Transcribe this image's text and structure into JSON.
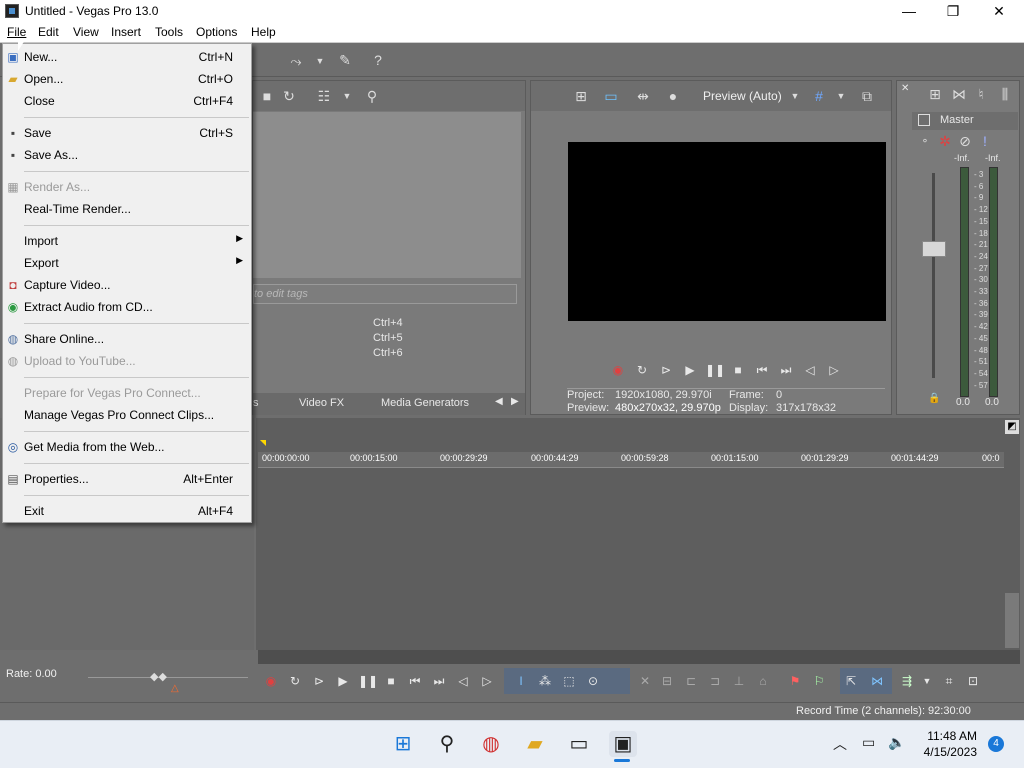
{
  "window": {
    "title": "Untitled - Vegas Pro 13.0",
    "minimize": "—",
    "maximize": "❐",
    "close": "✕"
  },
  "menubar": [
    "File",
    "Edit",
    "View",
    "Insert",
    "Tools",
    "Options",
    "Help"
  ],
  "file_menu": {
    "new": {
      "label": "New...",
      "shortcut": "Ctrl+N"
    },
    "open": {
      "label": "Open...",
      "shortcut": "Ctrl+O"
    },
    "close": {
      "label": "Close",
      "shortcut": "Ctrl+F4"
    },
    "save": {
      "label": "Save",
      "shortcut": "Ctrl+S"
    },
    "save_as": {
      "label": "Save As..."
    },
    "render_as": {
      "label": "Render As..."
    },
    "realtime": {
      "label": "Real-Time Render..."
    },
    "import": {
      "label": "Import"
    },
    "export": {
      "label": "Export"
    },
    "capture": {
      "label": "Capture Video..."
    },
    "extract": {
      "label": "Extract Audio from CD..."
    },
    "share": {
      "label": "Share Online..."
    },
    "upload": {
      "label": "Upload to YouTube..."
    },
    "prepare": {
      "label": "Prepare for Vegas Pro Connect..."
    },
    "manage": {
      "label": "Manage Vegas Pro Connect Clips..."
    },
    "getmedia": {
      "label": "Get Media from the Web..."
    },
    "properties": {
      "label": "Properties...",
      "shortcut": "Alt+Enter"
    },
    "exit": {
      "label": "Exit",
      "shortcut": "Alt+F4"
    }
  },
  "explorer": {
    "tags_placeholder": "to edit tags",
    "shortcuts": [
      "Ctrl+4",
      "Ctrl+5",
      "Ctrl+6"
    ],
    "tabs": [
      "s",
      "Video FX",
      "Media Generators"
    ]
  },
  "preview": {
    "mode": "Preview (Auto)",
    "project_label": "Project:",
    "project_value": "1920x1080, 29.970i",
    "frame_label": "Frame:",
    "frame_value": "0",
    "preview_label": "Preview:",
    "preview_value": "480x270x32, 29.970p",
    "display_label": "Display:",
    "display_value": "317x178x32"
  },
  "mixer": {
    "master": "Master",
    "inf_left": "-Inf.",
    "inf_right": "-Inf.",
    "scale": [
      "3",
      "6",
      "9",
      "12",
      "15",
      "18",
      "21",
      "24",
      "27",
      "30",
      "33",
      "36",
      "39",
      "42",
      "45",
      "48",
      "51",
      "54",
      "57"
    ],
    "level_left": "0.0",
    "level_right": "0.0"
  },
  "timeline": {
    "ticks": [
      "00:00:00:00",
      "00:00:15:00",
      "00:00:29:29",
      "00:00:44:29",
      "00:00:59:28",
      "00:01:15:00",
      "00:01:29:29",
      "00:01:44:29",
      "00:0"
    ]
  },
  "rate": "Rate: 0.00",
  "status": "Record Time (2 channels): 92:30:00",
  "taskbar": {
    "time": "11:48 AM",
    "date": "4/15/2023",
    "notifications": "4"
  }
}
